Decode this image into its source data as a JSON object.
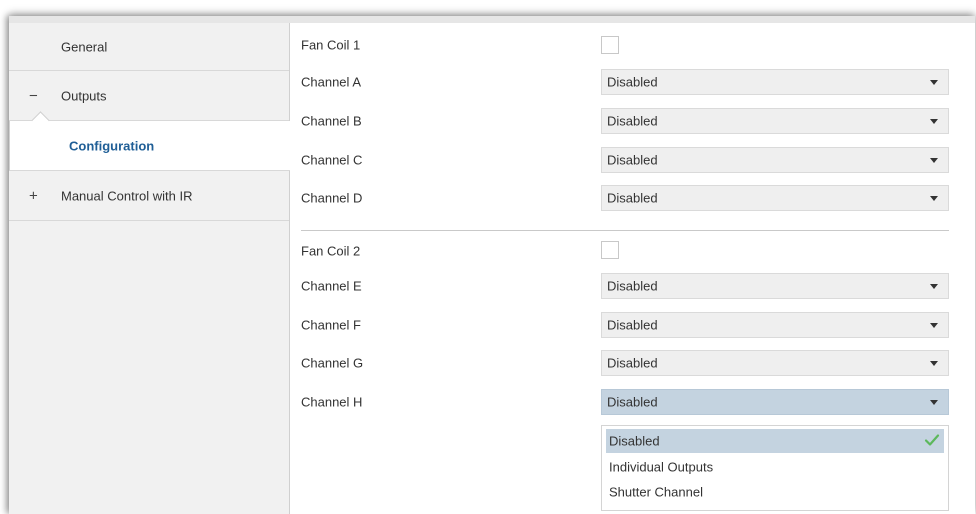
{
  "sidebar": {
    "items": [
      {
        "label": "General",
        "sign": ""
      },
      {
        "label": "Outputs",
        "sign": "−"
      },
      {
        "label": "Configuration",
        "sign": ""
      },
      {
        "label": "Manual Control with IR",
        "sign": "+"
      }
    ]
  },
  "config": {
    "fan_coil_1": {
      "label": "Fan Coil 1",
      "checked": false
    },
    "fan_coil_2": {
      "label": "Fan Coil 2",
      "checked": false
    },
    "channels": [
      {
        "label": "Channel A",
        "value": "Disabled"
      },
      {
        "label": "Channel B",
        "value": "Disabled"
      },
      {
        "label": "Channel C",
        "value": "Disabled"
      },
      {
        "label": "Channel D",
        "value": "Disabled"
      },
      {
        "label": "Channel E",
        "value": "Disabled"
      },
      {
        "label": "Channel F",
        "value": "Disabled"
      },
      {
        "label": "Channel G",
        "value": "Disabled"
      },
      {
        "label": "Channel H",
        "value": "Disabled"
      }
    ]
  },
  "dropdown": {
    "open_for": "Channel H",
    "options": [
      "Disabled",
      "Individual Outputs",
      "Shutter Channel"
    ],
    "selected": "Disabled"
  },
  "colors": {
    "accent": "#1f5e96",
    "selection": "#c4d3e0",
    "check": "#5cb85c"
  },
  "icons": {
    "dropdown_arrow": "chevron-down-icon",
    "selected_mark": "checkmark-icon"
  }
}
